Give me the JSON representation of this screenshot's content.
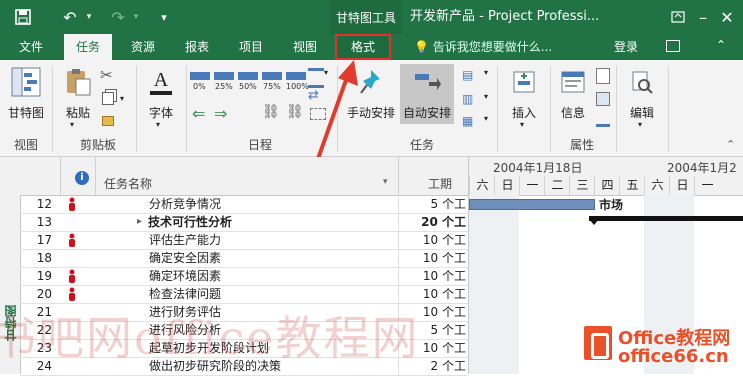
{
  "titlebar": {
    "context_tab_group": "甘特图工具",
    "document_title": "开发新产品 - Project Professi..."
  },
  "tabs": [
    {
      "label": "文件"
    },
    {
      "label": "任务"
    },
    {
      "label": "资源"
    },
    {
      "label": "报表"
    },
    {
      "label": "项目"
    },
    {
      "label": "视图"
    },
    {
      "label": "格式"
    }
  ],
  "tell_me": "告诉我您想要做什么...",
  "signin": "登录",
  "ribbon": {
    "gantt_label": "甘特图",
    "view_group": "视图",
    "paste_label": "粘贴",
    "clipboard_group": "剪贴板",
    "font_label": "字体",
    "schedule_group": "日程",
    "manual_label": "手动安排",
    "auto_label": "自动安排",
    "tasks_group": "任务",
    "insert_label": "插入",
    "info_label": "信息",
    "properties_group": "属性",
    "edit_label": "编辑"
  },
  "grid": {
    "header_name": "任务名称",
    "header_duration": "工期",
    "week1": "2004年1月18日",
    "week2": "2004年1月2",
    "days": [
      "六",
      "日",
      "一",
      "二",
      "三",
      "四",
      "五",
      "六",
      "日",
      "一"
    ],
    "rows": [
      {
        "id": "12",
        "name": "分析竞争情况",
        "duration": "5 个工",
        "icon": true,
        "bold": false,
        "summary": false
      },
      {
        "id": "13",
        "name": "技术可行性分析",
        "duration": "20 个工",
        "icon": false,
        "bold": true,
        "summary": true
      },
      {
        "id": "17",
        "name": "评估生产能力",
        "duration": "10 个工",
        "icon": true,
        "bold": false,
        "summary": false
      },
      {
        "id": "18",
        "name": "确定安全因素",
        "duration": "10 个工",
        "icon": false,
        "bold": false,
        "summary": false
      },
      {
        "id": "19",
        "name": "确定环境因素",
        "duration": "10 个工",
        "icon": true,
        "bold": false,
        "summary": false
      },
      {
        "id": "20",
        "name": "检查法律问题",
        "duration": "10 个工",
        "icon": true,
        "bold": false,
        "summary": false
      },
      {
        "id": "21",
        "name": "进行财务评估",
        "duration": "10 个工",
        "icon": false,
        "bold": false,
        "summary": false
      },
      {
        "id": "22",
        "name": "进行风险分析",
        "duration": "5 个工",
        "icon": false,
        "bold": false,
        "summary": false
      },
      {
        "id": "23",
        "name": "起草初步开发阶段计划",
        "duration": "10 个工",
        "icon": false,
        "bold": false,
        "summary": false
      },
      {
        "id": "24",
        "name": "做出初步研究阶段的决策",
        "duration": "2 个工",
        "icon": false,
        "bold": false,
        "summary": false
      }
    ],
    "gantt_label_market": "市场"
  },
  "side_tab": "甘特图",
  "watermarks": {
    "main": "书吧网office教程网",
    "logo_title": "Office教程网",
    "logo_url": "office66.cn"
  },
  "colors": {
    "ribbon_green": "#217346",
    "highlight_red": "#e5312e",
    "arrow_red": "#e23a2d",
    "resource_icon_red": "#d0101a"
  }
}
